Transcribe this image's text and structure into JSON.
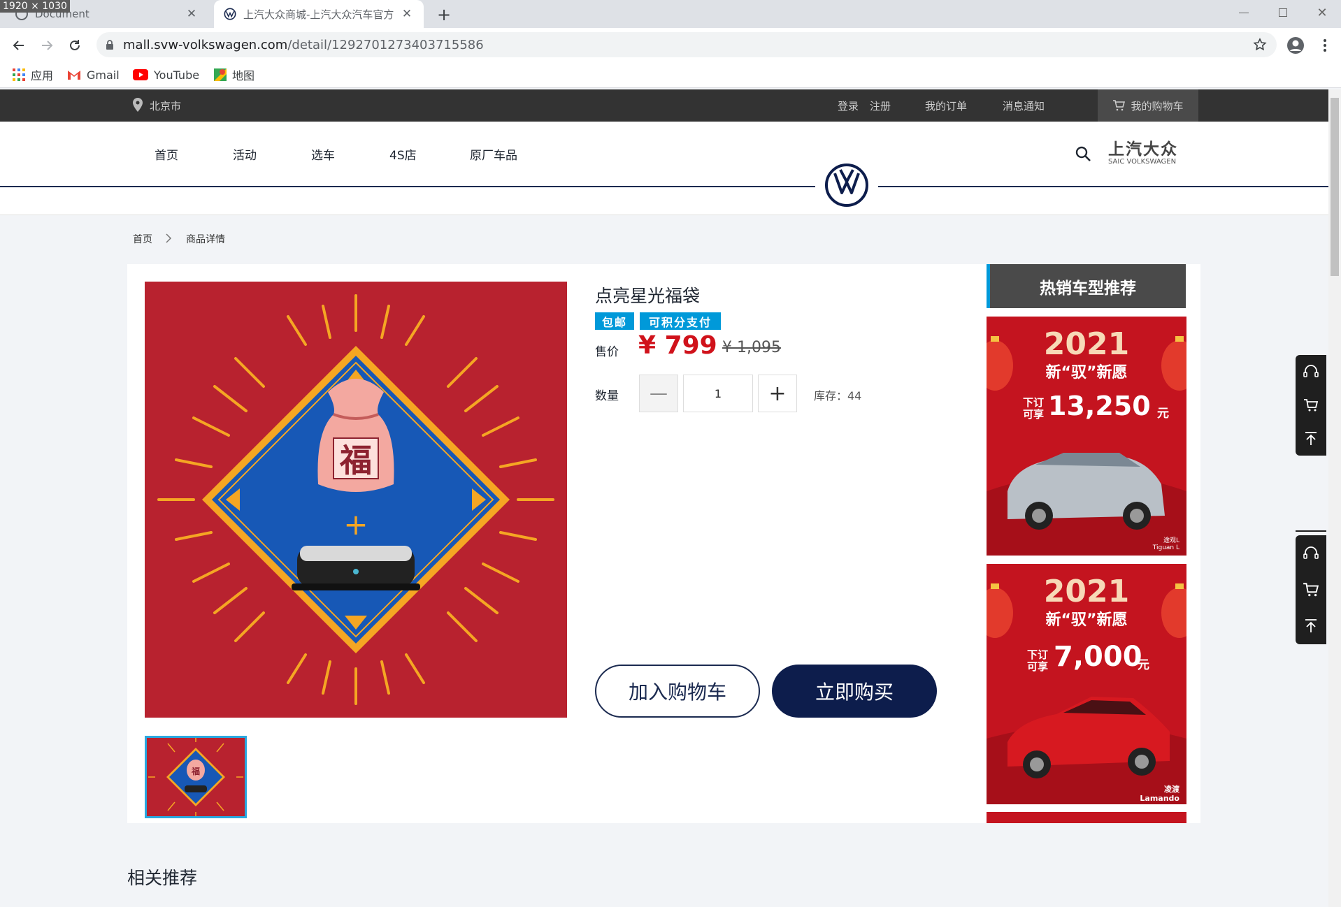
{
  "browser": {
    "dimension_badge": "1920 × 1030",
    "tabs": [
      {
        "title": "Document"
      },
      {
        "title": "上汽大众商城-上汽大众汽车官方"
      }
    ],
    "url_host": "mall.svw-volkswagen.com",
    "url_path": "/detail/1292701273403715586",
    "bookmarks": [
      {
        "label": "应用",
        "icon": "apps-grid-icon"
      },
      {
        "label": "Gmail",
        "icon": "gmail-icon"
      },
      {
        "label": "YouTube",
        "icon": "youtube-icon"
      },
      {
        "label": "地图",
        "icon": "maps-icon"
      }
    ]
  },
  "site": {
    "city": "北京市",
    "top_links": {
      "login": "登录",
      "register": "注册",
      "orders": "我的订单",
      "messages": "消息通知",
      "cart": "我的购物车"
    },
    "nav": [
      "首页",
      "活动",
      "选车",
      "4S店",
      "原厂车品"
    ],
    "brand_name": "上汽大众",
    "brand_sub": "SAIC VOLKSWAGEN"
  },
  "breadcrumb": {
    "home": "首页",
    "current": "商品详情"
  },
  "product": {
    "title": "点亮星光福袋",
    "badges": [
      "包邮",
      "可积分支付"
    ],
    "price_label": "售价",
    "price": "¥ 799",
    "original_price": "¥ 1,095",
    "qty_label": "数量",
    "minus": "—",
    "plus": "+",
    "qty": "1",
    "stock": "库存：44",
    "add_to_cart": "加入购物车",
    "buy_now": "立即购买",
    "image_char": "福",
    "image_plus": "+"
  },
  "hot": {
    "title": "热销车型推荐",
    "promos": [
      {
        "year": "2021",
        "slogan": "新“驭”新愿",
        "offer_prefix_1": "下订",
        "offer_prefix_2": "可享",
        "amount": "13,250",
        "unit": "元",
        "model_cn": "途观L",
        "model_en": "Tiguan L"
      },
      {
        "year": "2021",
        "slogan": "新“驭”新愿",
        "offer_prefix_1": "下订",
        "offer_prefix_2": "可享",
        "amount": "7,000",
        "unit": "元",
        "model_cn": "凌渡",
        "model_en": "Lamando"
      }
    ]
  },
  "related_title": "相关推荐",
  "colors": {
    "accent": "#0099d9",
    "price": "#d0121b",
    "navy": "#0d1d4c",
    "product_bg": "#b8222f"
  }
}
